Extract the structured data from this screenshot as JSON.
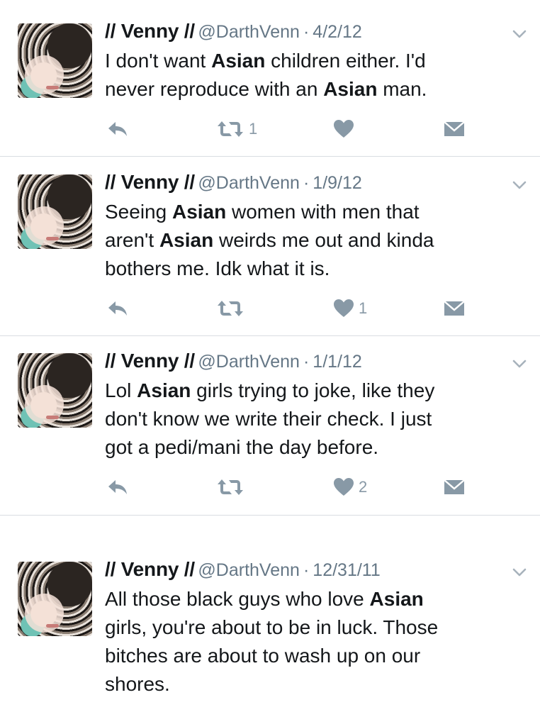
{
  "tweets": [
    {
      "name": "// Venny //",
      "handle": "@DarthVenn",
      "sep": "·",
      "date": "4/2/12",
      "text_parts": [
        "I don't want ",
        "Asian",
        " children either. I'd",
        "never reproduce with an ",
        "Asian",
        " man."
      ],
      "retweet_count": "1",
      "like_count": ""
    },
    {
      "name": "// Venny //",
      "handle": "@DarthVenn",
      "sep": "·",
      "date": "1/9/12",
      "text_parts": [
        "Seeing ",
        "Asian",
        " women with men that",
        "aren't ",
        "Asian",
        " weirds me out and kinda",
        "bothers me. Idk what it is."
      ],
      "retweet_count": "",
      "like_count": "1"
    },
    {
      "name": "// Venny //",
      "handle": "@DarthVenn",
      "sep": "·",
      "date": "1/1/12",
      "text_parts": [
        "Lol ",
        "Asian",
        " girls trying to joke, like they",
        "don't know we write their check. I just",
        "got a pedi/mani the day before."
      ],
      "retweet_count": "",
      "like_count": "2"
    },
    {
      "name": "// Venny //",
      "handle": "@DarthVenn",
      "sep": "·",
      "date": "12/31/11",
      "text_parts": [
        "All those black guys who love ",
        "Asian",
        "girls, you're about to be in luck. Those",
        "bitches are about to wash up on our",
        "shores."
      ]
    }
  ],
  "icons": {
    "reply": "reply-icon",
    "retweet": "retweet-icon",
    "like": "heart-icon",
    "dm": "envelope-icon",
    "more": "chevron-down-icon"
  },
  "colors": {
    "icon": "#8899a6",
    "divider": "#d9dde2",
    "meta": "#657786"
  }
}
